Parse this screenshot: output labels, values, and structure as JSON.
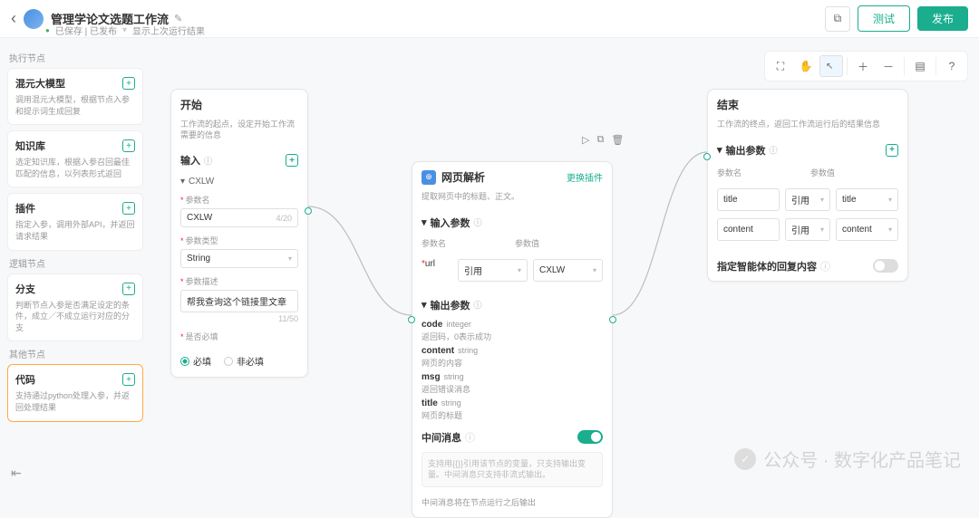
{
  "header": {
    "title": "管理学论文选题工作流",
    "status": "已保存 | 已发布",
    "show_last": "显示上次运行结果",
    "test": "测试",
    "publish": "发布"
  },
  "sidebar": {
    "sect_exec": "执行节点",
    "sect_logic": "逻辑节点",
    "sect_other": "其他节点",
    "items": [
      {
        "title": "混元大模型",
        "desc": "调用混元大模型，根据节点入参和提示词生成回复"
      },
      {
        "title": "知识库",
        "desc": "选定知识库，根据入参召回最佳匹配的信息，以列表形式返回"
      },
      {
        "title": "插件",
        "desc": "指定入参，调用外部API，并返回请求结果"
      },
      {
        "title": "分支",
        "desc": "判断节点入参是否满足设定的条件，成立／不成立运行对应的分支"
      },
      {
        "title": "代码",
        "desc": "支持通过python处理入参，并返回处理结果"
      }
    ]
  },
  "start": {
    "title": "开始",
    "sub": "工作流的起点，设定开始工作流需要的信息",
    "input_label": "输入",
    "group": "CXLW",
    "param_name_label": "参数名",
    "param_name": "CXLW",
    "param_name_count": "4/20",
    "param_type_label": "参数类型",
    "param_type": "String",
    "param_desc_label": "参数描述",
    "param_desc": "帮我查询这个链接里文章",
    "param_desc_count": "11/50",
    "required_label": "是否必填",
    "req_yes": "必填",
    "req_no": "非必填"
  },
  "web": {
    "title": "网页解析",
    "sub": "提取网页中的标题、正文。",
    "swap": "更换插件",
    "input_label": "输入参数",
    "pname": "参数名",
    "pval": "参数值",
    "url_key": "url",
    "url_ref": "引用",
    "url_val": "CXLW",
    "output_label": "输出参数",
    "outs": [
      {
        "k": "code",
        "t": "integer",
        "d": "返回码，0表示成功"
      },
      {
        "k": "content",
        "t": "string",
        "d": "网页的内容"
      },
      {
        "k": "msg",
        "t": "string",
        "d": "返回错误消息"
      },
      {
        "k": "title",
        "t": "string",
        "d": "网页的标题"
      }
    ],
    "mid": "中间消息",
    "mid_ph": "支持用{{}}引用该节点的变量，只支持输出变量。中间消息只支持非流式输出。",
    "mid_note": "中间消息将在节点运行之后输出"
  },
  "end": {
    "title": "结束",
    "sub": "工作流的终点，返回工作流运行后的结果信息",
    "output_label": "输出参数",
    "pname": "参数名",
    "pval": "参数值",
    "rows": [
      {
        "name": "title",
        "ref": "引用",
        "val": "title"
      },
      {
        "name": "content",
        "ref": "引用",
        "val": "content"
      }
    ],
    "agent_reply": "指定智能体的回复内容"
  },
  "watermark": "公众号 · 数字化产品笔记"
}
